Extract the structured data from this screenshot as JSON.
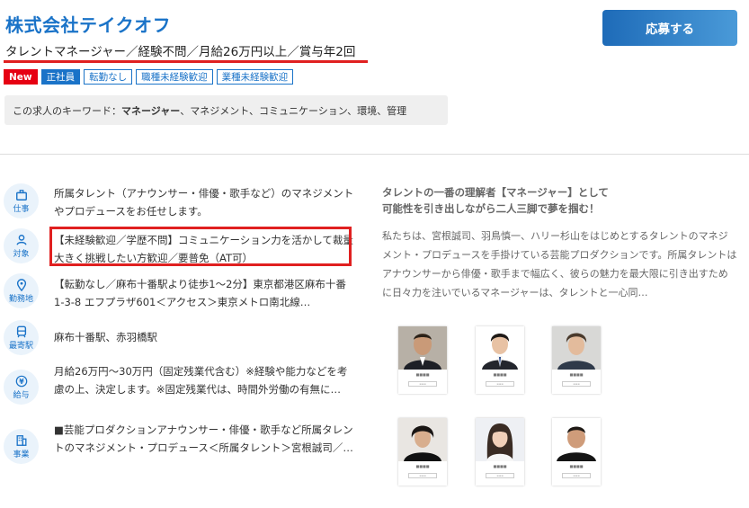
{
  "header": {
    "company": "株式会社テイクオフ",
    "job_title": "タレントマネージャー／経験不問／月給26万円以上／賞与年2回",
    "apply_label": "応募する"
  },
  "tags": [
    "New",
    "正社員",
    "転勤なし",
    "職種未経験歓迎",
    "業種未経験歓迎"
  ],
  "keywords": {
    "prefix": "この求人のキーワード：",
    "strong": "マネージャー",
    "rest": "、マネジメント、コミュニケーション、環境、管理"
  },
  "details": [
    {
      "icon": "briefcase-icon",
      "label": "仕事",
      "text": "所属タレント（アナウンサー・俳優・歌手など）のマネジメントやプロデュースをお任せします。"
    },
    {
      "icon": "person-icon",
      "label": "対象",
      "text": "【未経験歓迎／学歴不問】コミュニケーション力を活かして裁量大きく挑戦したい方歓迎／要普免（AT可）"
    },
    {
      "icon": "map-pin-icon",
      "label": "勤務地",
      "text": "【転勤なし／麻布十番駅より徒歩1～2分】東京都港区麻布十番1-3-8 エフプラザ601＜アクセス＞東京メトロ南北線…"
    },
    {
      "icon": "train-icon",
      "label": "最寄駅",
      "text": "麻布十番駅、赤羽橋駅"
    },
    {
      "icon": "yen-icon",
      "label": "給与",
      "text": "月給26万円～30万円（固定残業代含む）※経験や能力などを考慮の上、決定します。※固定残業代は、時間外労働の有無に…"
    },
    {
      "icon": "building-icon",
      "label": "事業",
      "text": "■芸能プロダクションアナウンサー・俳優・歌手など所属タレントのマネジメント・プロデュース＜所属タレント＞宮根誠司／…"
    }
  ],
  "right": {
    "heading_line1": "タレントの一番の理解者【マネージャー】として",
    "heading_line2": "可能性を引き出しながら二人三脚で夢を掴む！",
    "body": "私たちは、宮根誠司、羽鳥慎一、ハリー杉山をはじめとするタレントのマネジメント・プロデュースを手掛けている芸能プロダクションです。所属タレントはアナウンサーから俳優・歌手まで幅広く、彼らの魅力を最大限に引き出すために日々力を注いでいるマネージャーは、タレントと一心同…"
  },
  "colors": {
    "accent": "#1a73c8",
    "new": "#e60012",
    "highlight": "#e02020"
  }
}
